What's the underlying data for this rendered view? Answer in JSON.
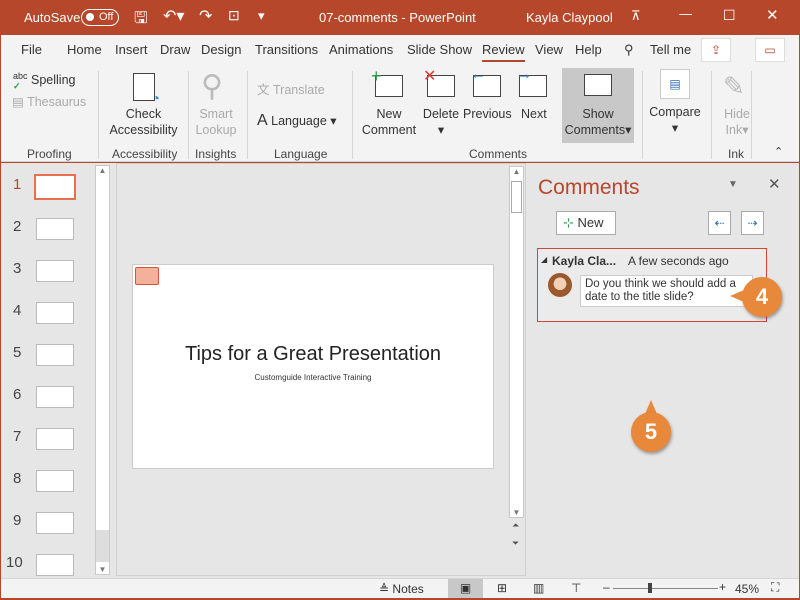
{
  "titlebar": {
    "autosave": "AutoSave",
    "toggle": "Off",
    "title": "07-comments  -  PowerPoint",
    "user": "Kayla Claypool"
  },
  "tabs": [
    "File",
    "Home",
    "Insert",
    "Draw",
    "Design",
    "Transitions",
    "Animations",
    "Slide Show",
    "Review",
    "View",
    "Help"
  ],
  "active_tab": "Review",
  "tell_me": "Tell me",
  "ribbon": {
    "spelling": "Spelling",
    "thesaurus": "Thesaurus",
    "proofing": "Proofing",
    "check": "Check",
    "accessibility_btn": "Accessibility",
    "accessibility": "Accessibility",
    "smart": "Smart",
    "lookup": "Lookup",
    "insights": "Insights",
    "translate": "Translate",
    "language_btn": "Language",
    "language": "Language",
    "new": "New",
    "comment": "Comment",
    "delete": "Delete",
    "previous": "Previous",
    "next": "Next",
    "show": "Show",
    "comments_btn": "Comments",
    "comments": "Comments",
    "compare": "Compare",
    "hide": "Hide",
    "ink_btn": "Ink",
    "ink": "Ink"
  },
  "slides": [
    "1",
    "2",
    "3",
    "4",
    "5",
    "6",
    "7",
    "8",
    "9",
    "10"
  ],
  "current_slide": 1,
  "slide": {
    "title": "Tips for a Great Presentation",
    "subtitle": "Customguide Interactive Training"
  },
  "pane": {
    "title": "Comments",
    "new": "New",
    "author": "Kayla Cla...",
    "time": "A few seconds ago",
    "text": "Do you think we should add a date to the title slide?"
  },
  "callouts": [
    "4",
    "5"
  ],
  "status": {
    "notes": "Notes",
    "zoom": "45%"
  },
  "colors": {
    "accent": "#b7472a",
    "callout": "#e8883a"
  }
}
